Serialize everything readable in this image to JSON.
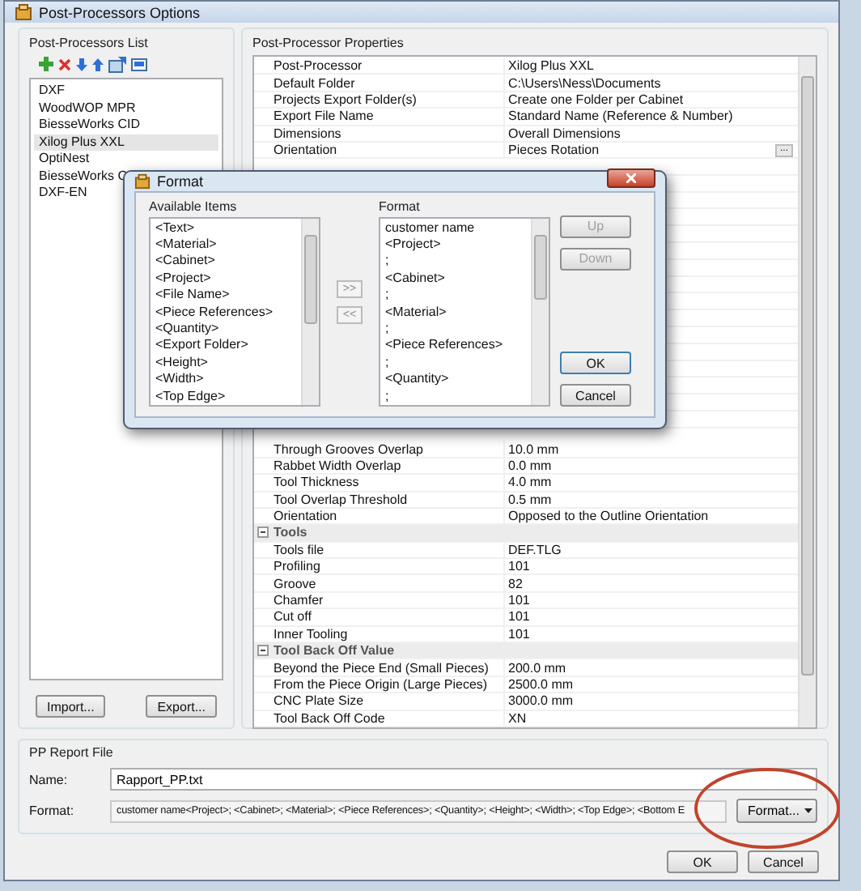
{
  "window": {
    "title": "Post-Processors Options"
  },
  "postprocessors": {
    "title": "Post-Processors List",
    "items": [
      {
        "label": "DXF",
        "selected": false
      },
      {
        "label": "WoodWOP MPR",
        "selected": false
      },
      {
        "label": "BiesseWorks CID",
        "selected": false
      },
      {
        "label": "Xilog Plus XXL",
        "selected": true
      },
      {
        "label": "OptiNest",
        "selected": false
      },
      {
        "label": "BiesseWorks C",
        "selected": false
      },
      {
        "label": "DXF-EN",
        "selected": false
      }
    ],
    "buttons": [
      "Import...",
      "Export..."
    ]
  },
  "properties": {
    "title": "Post-Processor Properties",
    "rows_above": [
      {
        "kind": "row",
        "label": "Post-Processor",
        "value": "Xilog Plus XXL"
      },
      {
        "kind": "row",
        "label": "Default Folder",
        "value": "C:\\Users\\Ness\\Documents"
      },
      {
        "kind": "row",
        "label": "Projects Export Folder(s)",
        "value": "Create one Folder per Cabinet"
      },
      {
        "kind": "row",
        "label": "Export File Name",
        "value": "Standard Name (Reference & Number)"
      },
      {
        "kind": "row",
        "label": "Dimensions",
        "value": "Overall Dimensions"
      },
      {
        "kind": "row",
        "label": "Orientation",
        "value": "Pieces Rotation",
        "button": "..."
      }
    ],
    "rows_below": [
      {
        "kind": "row",
        "label": "Through Grooves Overlap",
        "value": "10.0 mm"
      },
      {
        "kind": "row",
        "label": "Rabbet Width Overlap",
        "value": "0.0 mm"
      },
      {
        "kind": "row",
        "label": "Tool Thickness",
        "value": "4.0 mm"
      },
      {
        "kind": "row",
        "label": "Tool Overlap Threshold",
        "value": "0.5 mm"
      },
      {
        "kind": "row",
        "label": "Orientation",
        "value": "Opposed to the Outline Orientation"
      },
      {
        "kind": "section",
        "label": "Tools",
        "expanded": true
      },
      {
        "kind": "row",
        "label": "Tools file",
        "value": "DEF.TLG"
      },
      {
        "kind": "row",
        "label": "Profiling",
        "value": "101"
      },
      {
        "kind": "row",
        "label": "Groove",
        "value": "82"
      },
      {
        "kind": "row",
        "label": "Chamfer",
        "value": "101"
      },
      {
        "kind": "row",
        "label": "Cut off",
        "value": "101"
      },
      {
        "kind": "row",
        "label": "Inner Tooling",
        "value": "101"
      },
      {
        "kind": "section",
        "label": "Tool Back Off Value",
        "expanded": true
      },
      {
        "kind": "row",
        "label": "Beyond the Piece End (Small Pieces)",
        "value": "200.0 mm"
      },
      {
        "kind": "row",
        "label": "From the Piece Origin (Large Pieces)",
        "value": "2500.0 mm"
      },
      {
        "kind": "row",
        "label": "CNC Plate Size",
        "value": "3000.0 mm"
      },
      {
        "kind": "row",
        "label": "Tool Back Off Code",
        "value": "XN"
      }
    ]
  },
  "report": {
    "title": "PP Report File",
    "name_label": "Name:",
    "name_value": "Rapport_PP.txt",
    "format_label": "Format:",
    "format_value": "customer name<Project>; <Cabinet>; <Material>; <Piece References>; <Quantity>; <Height>; <Width>; <Top Edge>; <Bottom E",
    "format_button": "Format..."
  },
  "buttons": [
    "OK",
    "Cancel"
  ],
  "format_dialog": {
    "title": "Format",
    "available_title": "Available Items",
    "available": [
      "<Text>",
      "<Material>",
      "<Cabinet>",
      "<Project>",
      "<File Name>",
      "<Piece References>",
      "<Quantity>",
      "<Export Folder>",
      "<Height>",
      "<Width>",
      "<Top Edge>"
    ],
    "format_title": "Format",
    "format": [
      "customer name",
      "<Project>",
      ";",
      "<Cabinet>",
      ";",
      "<Material>",
      ";",
      "<Piece References>",
      ";",
      "<Quantity>",
      ";"
    ],
    "add_button": ">>",
    "remove_button": "<<",
    "side_buttons": [
      {
        "label": "Up",
        "disabled": true,
        "default": false
      },
      {
        "label": "Down",
        "disabled": true,
        "default": false
      },
      {
        "label": "OK",
        "disabled": false,
        "default": true
      },
      {
        "label": "Cancel",
        "disabled": false,
        "default": false
      }
    ]
  }
}
